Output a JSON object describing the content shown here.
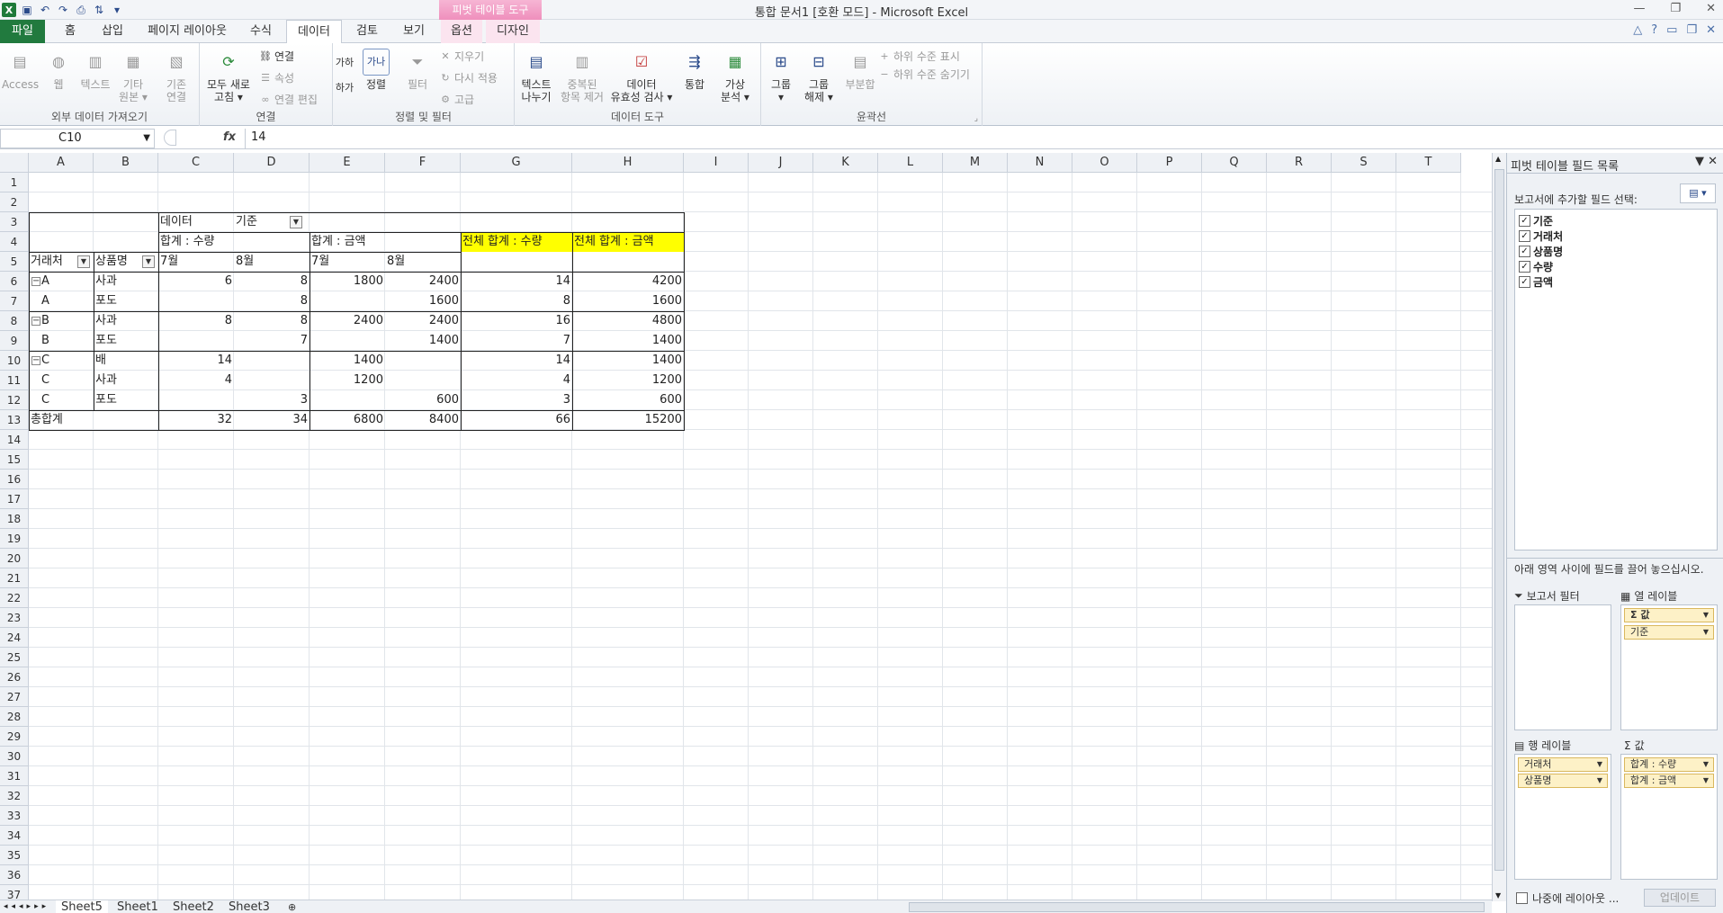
{
  "window": {
    "title": "통합 문서1  [호환 모드]  -  Microsoft Excel",
    "context_tool": "피벗 테이블 도구"
  },
  "qat": [
    "save-icon",
    "undo-icon",
    "redo-icon",
    "print-icon",
    "sort-icon"
  ],
  "tabs": {
    "file": "파일",
    "items": [
      "홈",
      "삽입",
      "페이지 레이아웃",
      "수식",
      "데이터",
      "검토",
      "보기",
      "옵션",
      "디자인"
    ],
    "active": "데이터"
  },
  "ribbon": {
    "ext": {
      "label": "외부 데이터 가져오기",
      "access": "Access",
      "web": "웹",
      "text": "텍스트",
      "other": "기타",
      "other2": "원본 ▾",
      "existing": "기존",
      "existing2": "연결"
    },
    "conn": {
      "label": "연결",
      "refresh": "모두 새로",
      "refresh2": "고침 ▾",
      "connections": "연결",
      "properties": "속성",
      "editlinks": "연결 편집"
    },
    "sort": {
      "label": "정렬 및 필터",
      "sort": "정렬",
      "filter": "필터",
      "clear": "지우기",
      "reapply": "다시 적용",
      "advanced": "고급",
      "az": "가나",
      "za": "하가",
      "ga": "가하"
    },
    "tools": {
      "label": "데이터 도구",
      "t2c": "텍스트",
      "t2c2": "나누기",
      "dup": "중복된",
      "dup2": "항목 제거",
      "valid": "데이터",
      "valid2": "유효성 검사 ▾",
      "consol": "통합",
      "whatif": "가상",
      "whatif2": "분석 ▾"
    },
    "outline": {
      "label": "윤곽선",
      "group": "그룹",
      "group2": "▾",
      "ungroup": "그룹",
      "ungroup2": "해제 ▾",
      "subtotal": "부분합",
      "show": "하위 수준 표시",
      "hide": "하위 수준 숨기기"
    }
  },
  "formula_bar": {
    "name_box": "C10",
    "fx": "fx",
    "value": "14"
  },
  "columns": [
    "A",
    "B",
    "C",
    "D",
    "E",
    "F",
    "G",
    "H",
    "I",
    "J",
    "K",
    "L",
    "M",
    "N",
    "O",
    "P",
    "Q",
    "R",
    "S",
    "T"
  ],
  "rows": [
    "1",
    "2",
    "3",
    "4",
    "5",
    "6",
    "7",
    "8",
    "9",
    "10",
    "11",
    "12",
    "13",
    "14",
    "15",
    "16",
    "17",
    "18",
    "19",
    "20",
    "21",
    "22",
    "23",
    "24",
    "25",
    "26",
    "27",
    "28",
    "29",
    "30",
    "31",
    "32",
    "33",
    "34",
    "35",
    "36",
    "37"
  ],
  "pivot": {
    "data_label": "데이터",
    "base_label": "기준",
    "sum_qty": "합계 : 수량",
    "sum_amt": "합계 : 금액",
    "total_qty": "전체 합계 : 수량",
    "total_amt": "전체 합계 : 금액",
    "col_customer": "거래처",
    "col_product": "상품명",
    "months": [
      "7월",
      "8월",
      "7월",
      "8월"
    ],
    "body": [
      {
        "c": "A",
        "p": "사과",
        "q7": "6",
        "q8": "8",
        "a7": "1800",
        "a8": "2400",
        "tq": "14",
        "ta": "4200",
        "collapse": true
      },
      {
        "c": "A",
        "p": "포도",
        "q7": "",
        "q8": "8",
        "a7": "",
        "a8": "1600",
        "tq": "8",
        "ta": "1600",
        "collapse": false
      },
      {
        "c": "B",
        "p": "사과",
        "q7": "8",
        "q8": "8",
        "a7": "2400",
        "a8": "2400",
        "tq": "16",
        "ta": "4800",
        "collapse": true
      },
      {
        "c": "B",
        "p": "포도",
        "q7": "",
        "q8": "7",
        "a7": "",
        "a8": "1400",
        "tq": "7",
        "ta": "1400",
        "collapse": false
      },
      {
        "c": "C",
        "p": "배",
        "q7": "14",
        "q8": "",
        "a7": "1400",
        "a8": "",
        "tq": "14",
        "ta": "1400",
        "collapse": true
      },
      {
        "c": "C",
        "p": "사과",
        "q7": "4",
        "q8": "",
        "a7": "1200",
        "a8": "",
        "tq": "4",
        "ta": "1200",
        "collapse": false
      },
      {
        "c": "C",
        "p": "포도",
        "q7": "",
        "q8": "3",
        "a7": "",
        "a8": "600",
        "tq": "3",
        "ta": "600",
        "collapse": false
      }
    ],
    "grand": {
      "label": "총합계",
      "q7": "32",
      "q8": "34",
      "a7": "6800",
      "a8": "8400",
      "tq": "66",
      "ta": "15200"
    }
  },
  "sheets": [
    "Sheet5",
    "Sheet1",
    "Sheet2",
    "Sheet3"
  ],
  "pane": {
    "title": "피벗 테이블 필드 목록",
    "subtitle": "보고서에 추가할 필드 선택:",
    "fields": [
      "기준",
      "거래처",
      "상품명",
      "수량",
      "금액"
    ],
    "drag_hint": "아래 영역 사이에 필드를 끌어 놓으십시오.",
    "report_filter": "보고서 필터",
    "col_labels": "열 레이블",
    "row_labels": "행 레이블",
    "values": "값",
    "col_items": [
      "Σ 값",
      "기준"
    ],
    "row_items": [
      "거래처",
      "상품명"
    ],
    "value_items": [
      "합계 : 수량",
      "합계 : 금액"
    ],
    "defer": "나중에 레이아웃 ...",
    "update": "업데이트"
  }
}
